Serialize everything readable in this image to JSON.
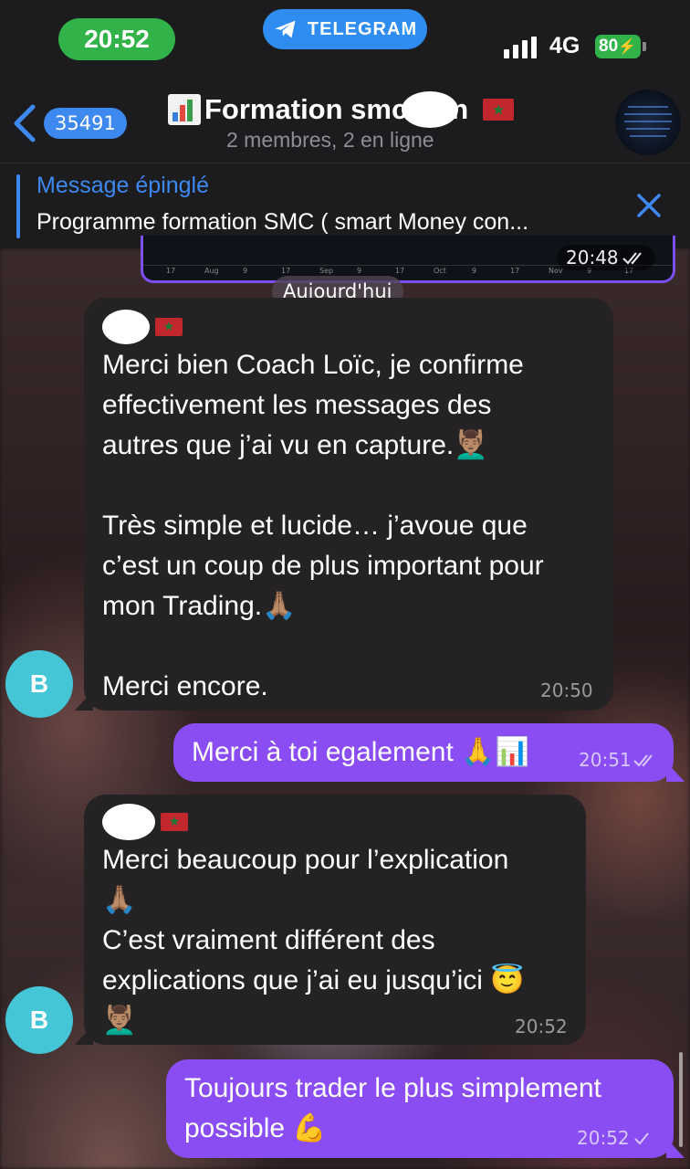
{
  "status_bar": {
    "time": "20:52",
    "app_pill": "TELEGRAM",
    "network": "4G",
    "battery": "80"
  },
  "header": {
    "back_badge": "35491",
    "title_start": "Formation smc",
    "title_end": "n",
    "subtitle": "2 membres, 2 en ligne"
  },
  "pinned": {
    "label": "Message épinglé",
    "text": "Programme formation SMC ( smart Money con..."
  },
  "previous_message": {
    "time": "20:48",
    "chart_ticks": [
      "17",
      "Aug",
      "9",
      "17",
      "Sep",
      "9",
      "17",
      "Oct",
      "9",
      "17",
      "Nov",
      "9",
      "17"
    ]
  },
  "date_separator": "Aujourd'hui",
  "messages": [
    {
      "direction": "in",
      "avatar_letter": "B",
      "text": "Merci bien Coach Loïc, je confirme\neffectivement les messages des\nautres que j’ai vu en capture.💆🏽‍♂️\n\nTrès simple et lucide… j’avoue que\nc’est un coup de plus important pour\nmon Trading.🙏🏽\n\nMerci encore.",
      "time": "20:50"
    },
    {
      "direction": "out",
      "text": "Merci à toi egalement 🙏📊",
      "time": "20:51"
    },
    {
      "direction": "in",
      "avatar_letter": "B",
      "text": "Merci beaucoup pour l’explication\n🙏🏽\nC’est vraiment différent des\nexplications que j’ai eu jusqu’ici 😇\n💆🏽‍♂️",
      "time": "20:52"
    },
    {
      "direction": "out",
      "text": "Toujours trader le plus simplement\npossible 💪",
      "time": "20:52"
    }
  ],
  "colors": {
    "accent": "#3d89f0",
    "outgoing_bubble": "#8a4cf3",
    "incoming_bubble": "#252223",
    "avatar": "#45c6d6",
    "time_pill": "#31b34a"
  },
  "icons": [
    "telegram-icon",
    "signal-icon",
    "back-chevron-icon",
    "bar-chart-icon",
    "morocco-flag-icon",
    "close-icon",
    "double-check-icon",
    "single-check-icon"
  ]
}
